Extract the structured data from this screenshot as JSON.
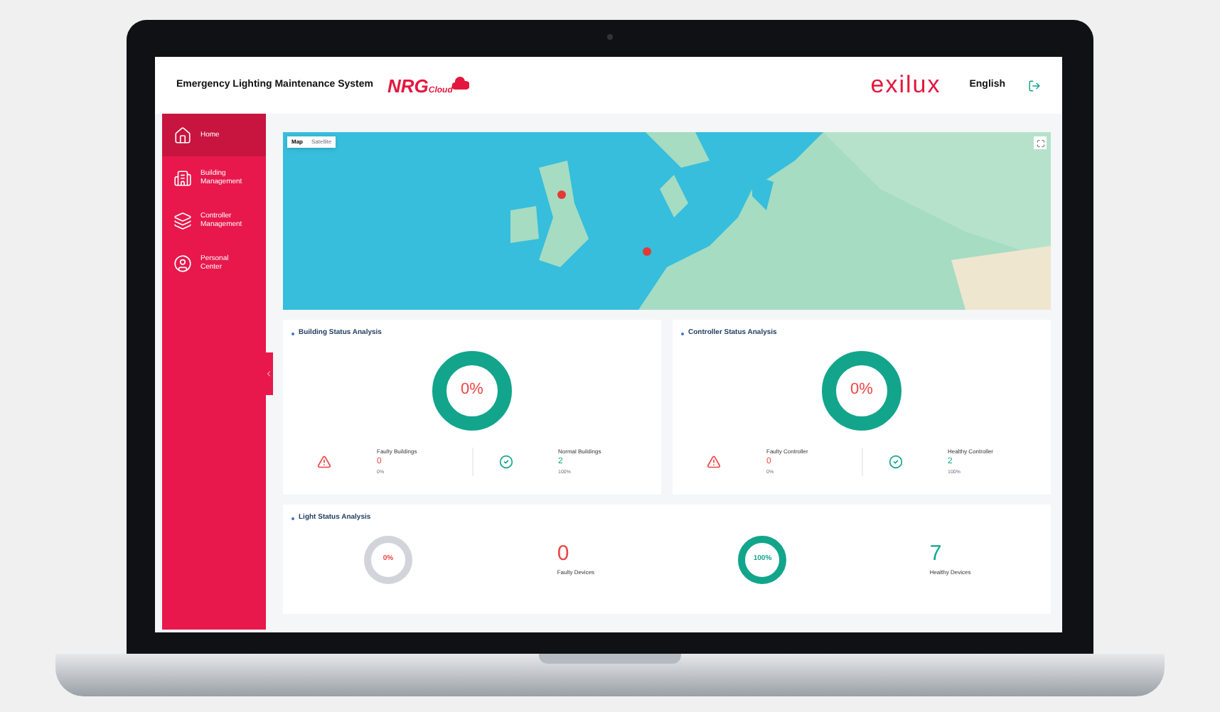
{
  "header": {
    "title": "Emergency Lighting Maintenance System",
    "logo_text": "NRG",
    "logo_sub": "Cloud",
    "brand": "exilux",
    "language": "English"
  },
  "sidebar": {
    "items": [
      {
        "kind": "home",
        "label": "Home",
        "selected": true
      },
      {
        "kind": "building",
        "label": "Building Management",
        "selected": false
      },
      {
        "kind": "controller",
        "label": "Controller Management",
        "selected": false
      },
      {
        "kind": "person",
        "label": "Personal Center",
        "selected": false
      }
    ]
  },
  "map": {
    "tabs": [
      {
        "label": "Map",
        "selected": true
      },
      {
        "label": "Satellite",
        "selected": false
      }
    ]
  },
  "panels": [
    {
      "title": "Building Status Analysis",
      "donut": {
        "label": "0%"
      },
      "stats": [
        {
          "kind": "faulty",
          "label": "Faulty Buildings",
          "value": "0",
          "percent": "0%"
        },
        {
          "kind": "healthy",
          "label": "Normal Buildings",
          "value": "2",
          "percent": "100%"
        }
      ]
    },
    {
      "title": "Controller Status Analysis",
      "donut": {
        "label": "0%"
      },
      "stats": [
        {
          "kind": "faulty",
          "label": "Faulty Controller",
          "value": "0",
          "percent": "0%"
        },
        {
          "kind": "healthy",
          "label": "Healthy Controller",
          "value": "2",
          "percent": "100%"
        }
      ]
    }
  ],
  "light_status": {
    "title": "Light Status Analysis",
    "items": [
      {
        "kind": "faulty",
        "donut": {
          "label": "0%"
        },
        "value": "0",
        "label": "Faulty Devices"
      },
      {
        "kind": "healthy",
        "donut": {
          "label": "100%"
        },
        "value": "7",
        "label": "Healthy Devices"
      }
    ]
  }
}
